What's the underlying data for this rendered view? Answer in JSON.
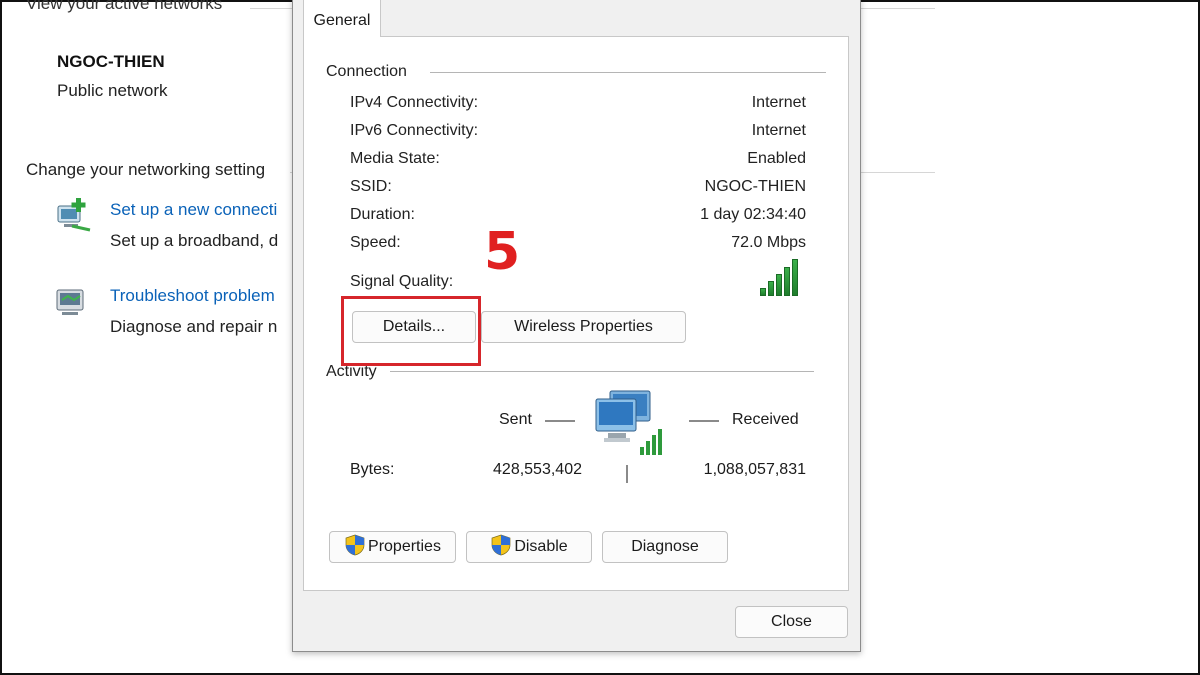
{
  "background": {
    "active_networks_heading": "View your active networks",
    "network_name": "NGOC-THIEN",
    "network_type": "Public network",
    "change_settings_heading": "Change your networking setting",
    "setup_link": "Set up a new connecti",
    "setup_desc": "Set up a broadband, d",
    "troubleshoot_link": "Troubleshoot problem",
    "troubleshoot_desc": "Diagnose and repair n"
  },
  "dialog": {
    "tab_label": "General",
    "connection": {
      "group_label": "Connection",
      "rows": [
        {
          "label": "IPv4 Connectivity:",
          "value": "Internet"
        },
        {
          "label": "IPv6 Connectivity:",
          "value": "Internet"
        },
        {
          "label": "Media State:",
          "value": "Enabled"
        },
        {
          "label": "SSID:",
          "value": "NGOC-THIEN"
        },
        {
          "label": "Duration:",
          "value": "1 day 02:34:40"
        },
        {
          "label": "Speed:",
          "value": "72.0 Mbps"
        }
      ],
      "signal_label": "Signal Quality:",
      "signal_bars": 5,
      "details_button": "Details...",
      "wireless_button": "Wireless Properties"
    },
    "activity": {
      "group_label": "Activity",
      "sent_label": "Sent",
      "received_label": "Received",
      "bytes_label": "Bytes:",
      "bytes_sent": "428,553,402",
      "bytes_received": "1,088,057,831"
    },
    "buttons": {
      "properties": "Properties",
      "disable": "Disable",
      "diagnose": "Diagnose",
      "close": "Close"
    }
  },
  "annotation": {
    "step_number": "5",
    "highlight_color": "#d6262b"
  },
  "colors": {
    "link": "#0a62b8",
    "signal": "#2e9a3c"
  }
}
